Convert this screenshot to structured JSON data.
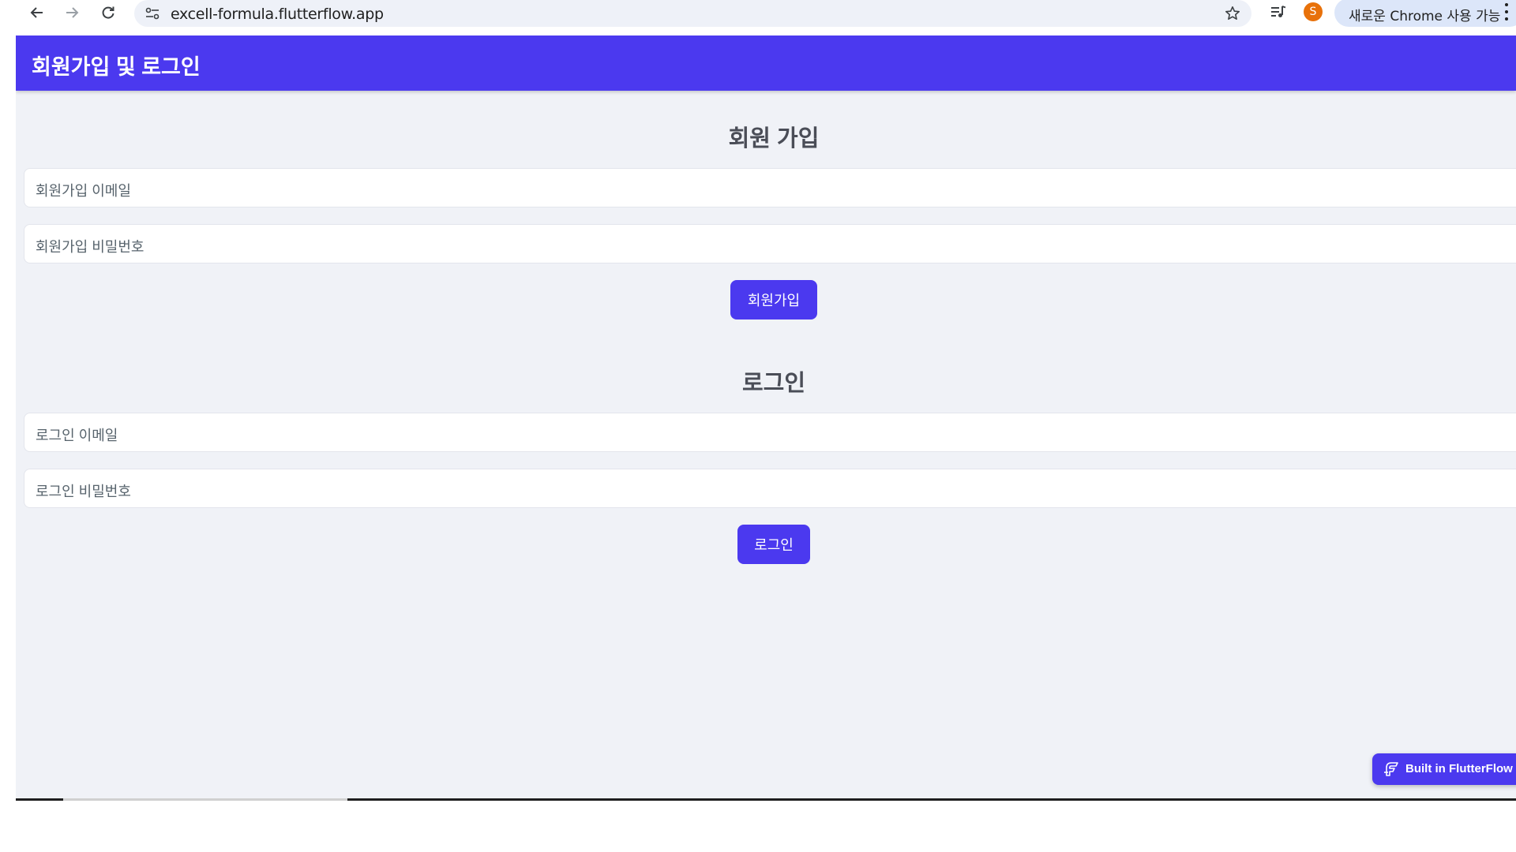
{
  "browser": {
    "url": "excell-formula.flutterflow.app",
    "profile_initial": "S",
    "update_label": "새로운 Chrome 사용 가능",
    "icons": {
      "back": "arrow-left-icon",
      "forward": "arrow-right-icon",
      "reload": "reload-icon",
      "site_info": "tune-icon",
      "bookmark": "star-icon",
      "media": "media-playlist-icon",
      "menu": "more-vert-icon"
    }
  },
  "app": {
    "title": "회원가입 및 로그인",
    "signup": {
      "heading": "회원 가입",
      "email_placeholder": "회원가입 이메일",
      "password_placeholder": "회원가입 비밀번호",
      "button_label": "회원가입"
    },
    "login": {
      "heading": "로그인",
      "email_placeholder": "로그인 이메일",
      "password_placeholder": "로그인 비밀번호",
      "button_label": "로그인"
    },
    "badge_label": "Built in FlutterFlow"
  },
  "colors": {
    "primary": "#4b39ef",
    "background": "#f0f2f7",
    "field": "#ffffff",
    "heading": "#4a4d57",
    "placeholder": "#57636c"
  }
}
